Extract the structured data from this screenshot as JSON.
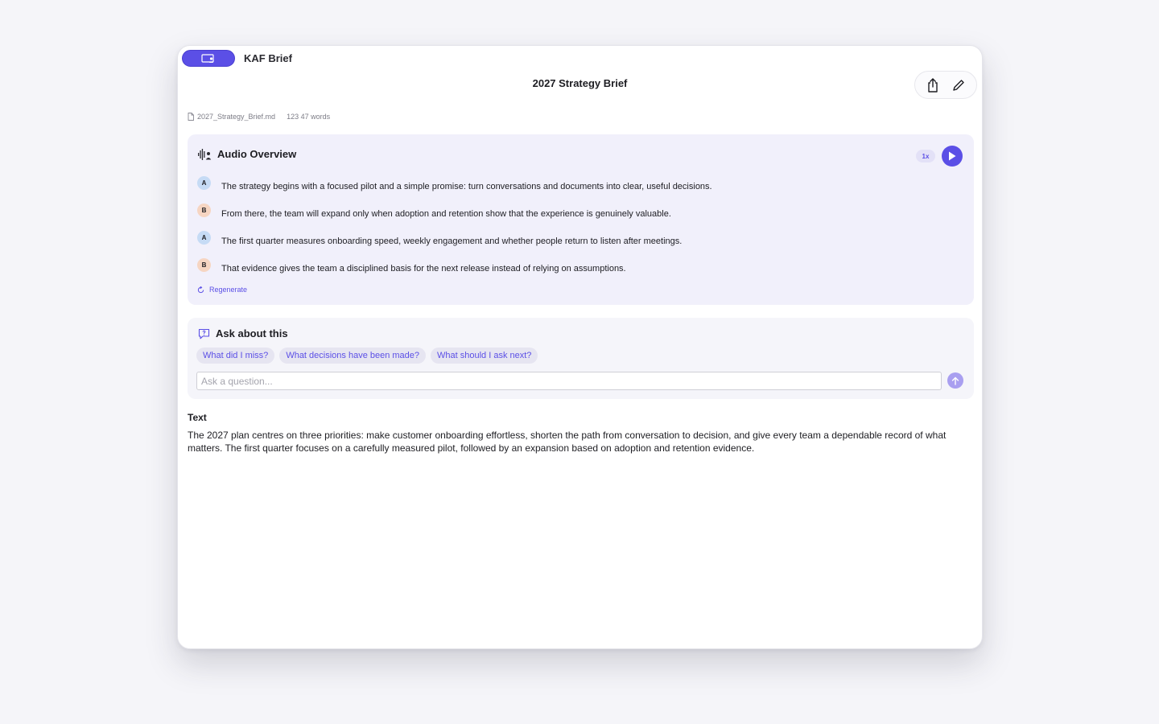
{
  "app": {
    "name": "KAF Brief"
  },
  "document": {
    "title": "2027 Strategy Brief",
    "filename": "2027_Strategy_Brief.md",
    "stats": "123 47 words"
  },
  "toolbar": {
    "share_icon": "share-icon",
    "edit_icon": "pencil-icon"
  },
  "audio_overview": {
    "title": "Audio Overview",
    "speed": "1x",
    "regenerate_label": "Regenerate",
    "turns": [
      {
        "speaker": "A",
        "text": "The strategy begins with a focused pilot and a simple promise: turn conversations and documents into clear, useful decisions."
      },
      {
        "speaker": "B",
        "text": "From there, the team will expand only when adoption and retention show that the experience is genuinely valuable."
      },
      {
        "speaker": "A",
        "text": "The first quarter measures onboarding speed, weekly engagement and whether people return to listen after meetings."
      },
      {
        "speaker": "B",
        "text": "That evidence gives the team a disciplined basis for the next release instead of relying on assumptions."
      }
    ]
  },
  "ask": {
    "title": "Ask about this",
    "suggestions": [
      "What did I miss?",
      "What decisions have been made?",
      "What should I ask next?"
    ],
    "input_placeholder": "Ask a question...",
    "input_value": ""
  },
  "text_section": {
    "label": "Text",
    "body": "The 2027 plan centres on three priorities: make customer onboarding effortless, shorten the path from conversation to decision, and give every team a dependable record of what matters. The first quarter focuses on a carefully measured pilot, followed by an expansion based on adoption and retention evidence."
  },
  "colors": {
    "accent": "#5b4fe6",
    "speaker_a": "#c6dbf5",
    "speaker_b": "#f6d5c2"
  }
}
